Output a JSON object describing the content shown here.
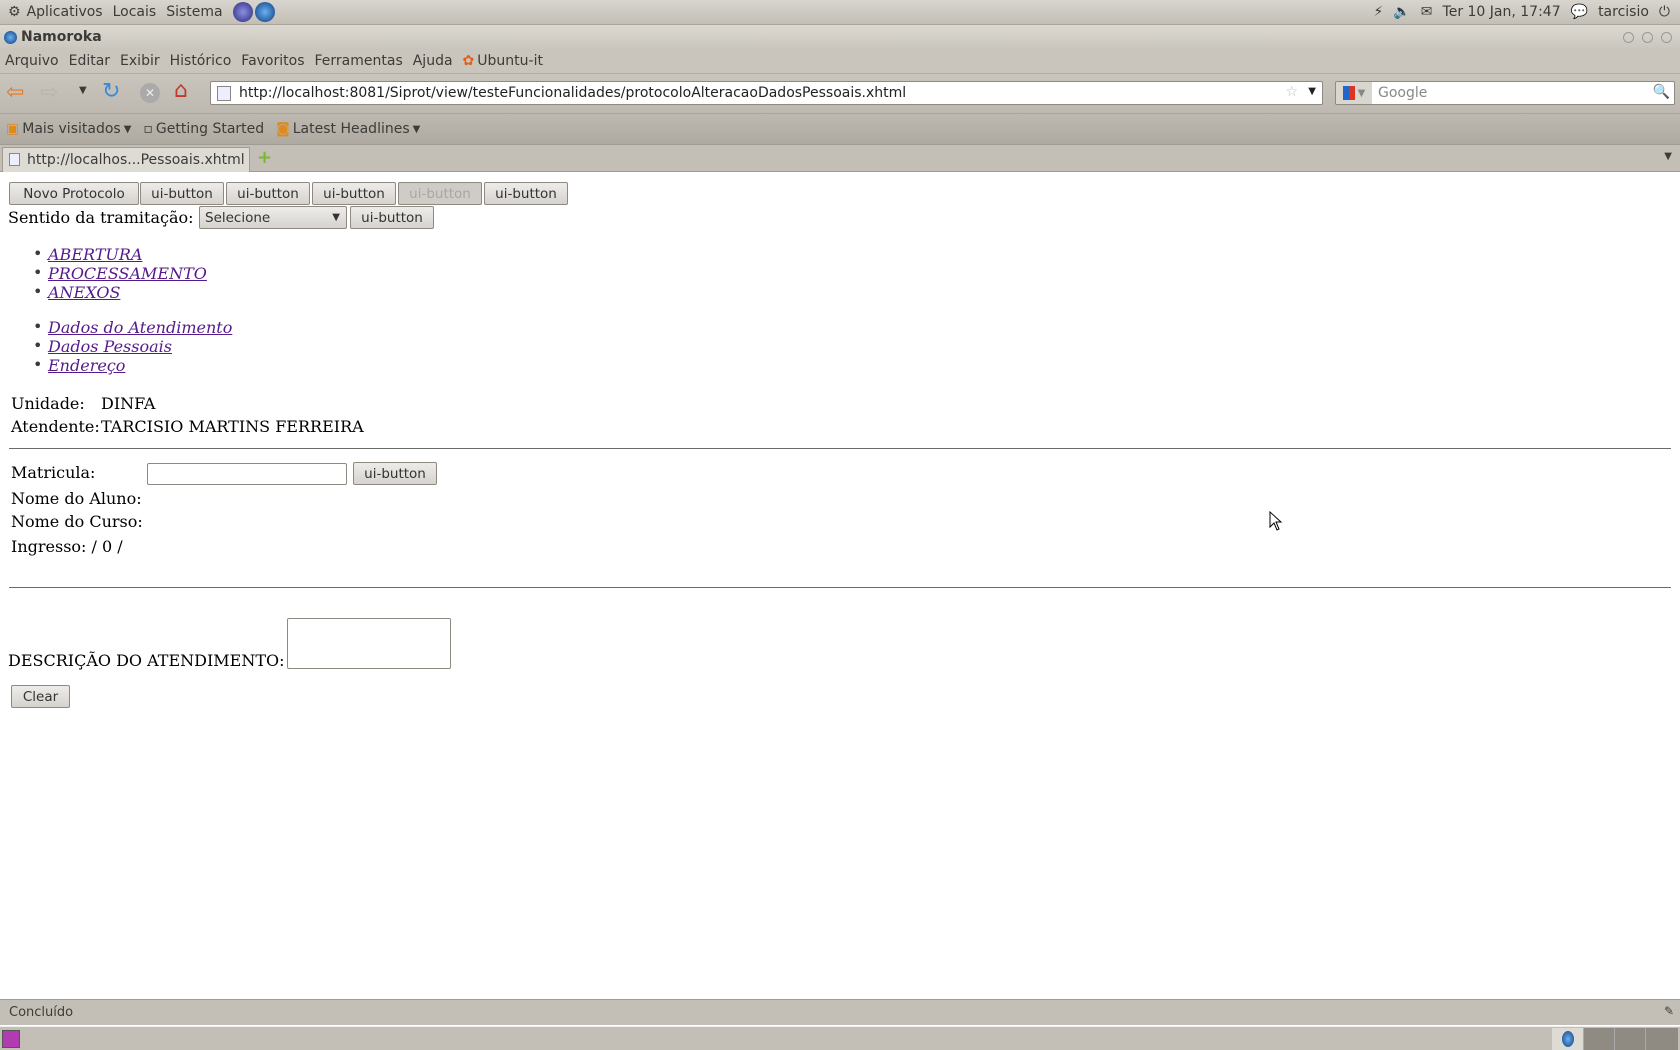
{
  "top_panel": {
    "menus": [
      "Aplicativos",
      "Locais",
      "Sistema"
    ],
    "datetime": "Ter 10 Jan, 17:47",
    "user": "tarcisio"
  },
  "window": {
    "title": "Namoroka"
  },
  "menubar": [
    "Arquivo",
    "Editar",
    "Exibir",
    "Histórico",
    "Favoritos",
    "Ferramentas",
    "Ajuda",
    "Ubuntu-it"
  ],
  "navbar": {
    "url": "http://localhost:8081/Siprot/view/testeFuncionalidades/protocoloAlteracaoDadosPessoais.xhtml",
    "search_placeholder": "Google"
  },
  "bookmarks": [
    "Mais visitados",
    "Getting Started",
    "Latest Headlines"
  ],
  "tab": {
    "title": "http://localhos...Pessoais.xhtml"
  },
  "page": {
    "toolbar_buttons": [
      {
        "label": "Novo Protocolo",
        "disabled": false
      },
      {
        "label": "ui-button",
        "disabled": false
      },
      {
        "label": "ui-button",
        "disabled": false
      },
      {
        "label": "ui-button",
        "disabled": false
      },
      {
        "label": "ui-button",
        "disabled": true
      },
      {
        "label": "ui-button",
        "disabled": false
      }
    ],
    "sentido_label": "Sentido da tramitação:",
    "sentido_select": "Selecione",
    "sentido_button": "ui-button",
    "steps": [
      "ABERTURA",
      "PROCESSAMENTO",
      "ANEXOS"
    ],
    "sections": [
      "Dados do Atendimento",
      "Dados Pessoais",
      "Endereço"
    ],
    "unidade_label": "Unidade:",
    "unidade_value": "DINFA",
    "atendente_label": "Atendente:",
    "atendente_value": "TARCISIO MARTINS FERREIRA",
    "matricula_label": "Matricula:",
    "matricula_value": "",
    "matricula_button": "ui-button",
    "nome_aluno_label": "Nome do Aluno:",
    "nome_curso_label": "Nome do Curso:",
    "ingresso": "Ingresso: / 0 /",
    "descricao_label": "DESCRIÇÃO DO ATENDIMENTO:",
    "clear_button": "Clear"
  },
  "status": {
    "text": "Concluído"
  }
}
